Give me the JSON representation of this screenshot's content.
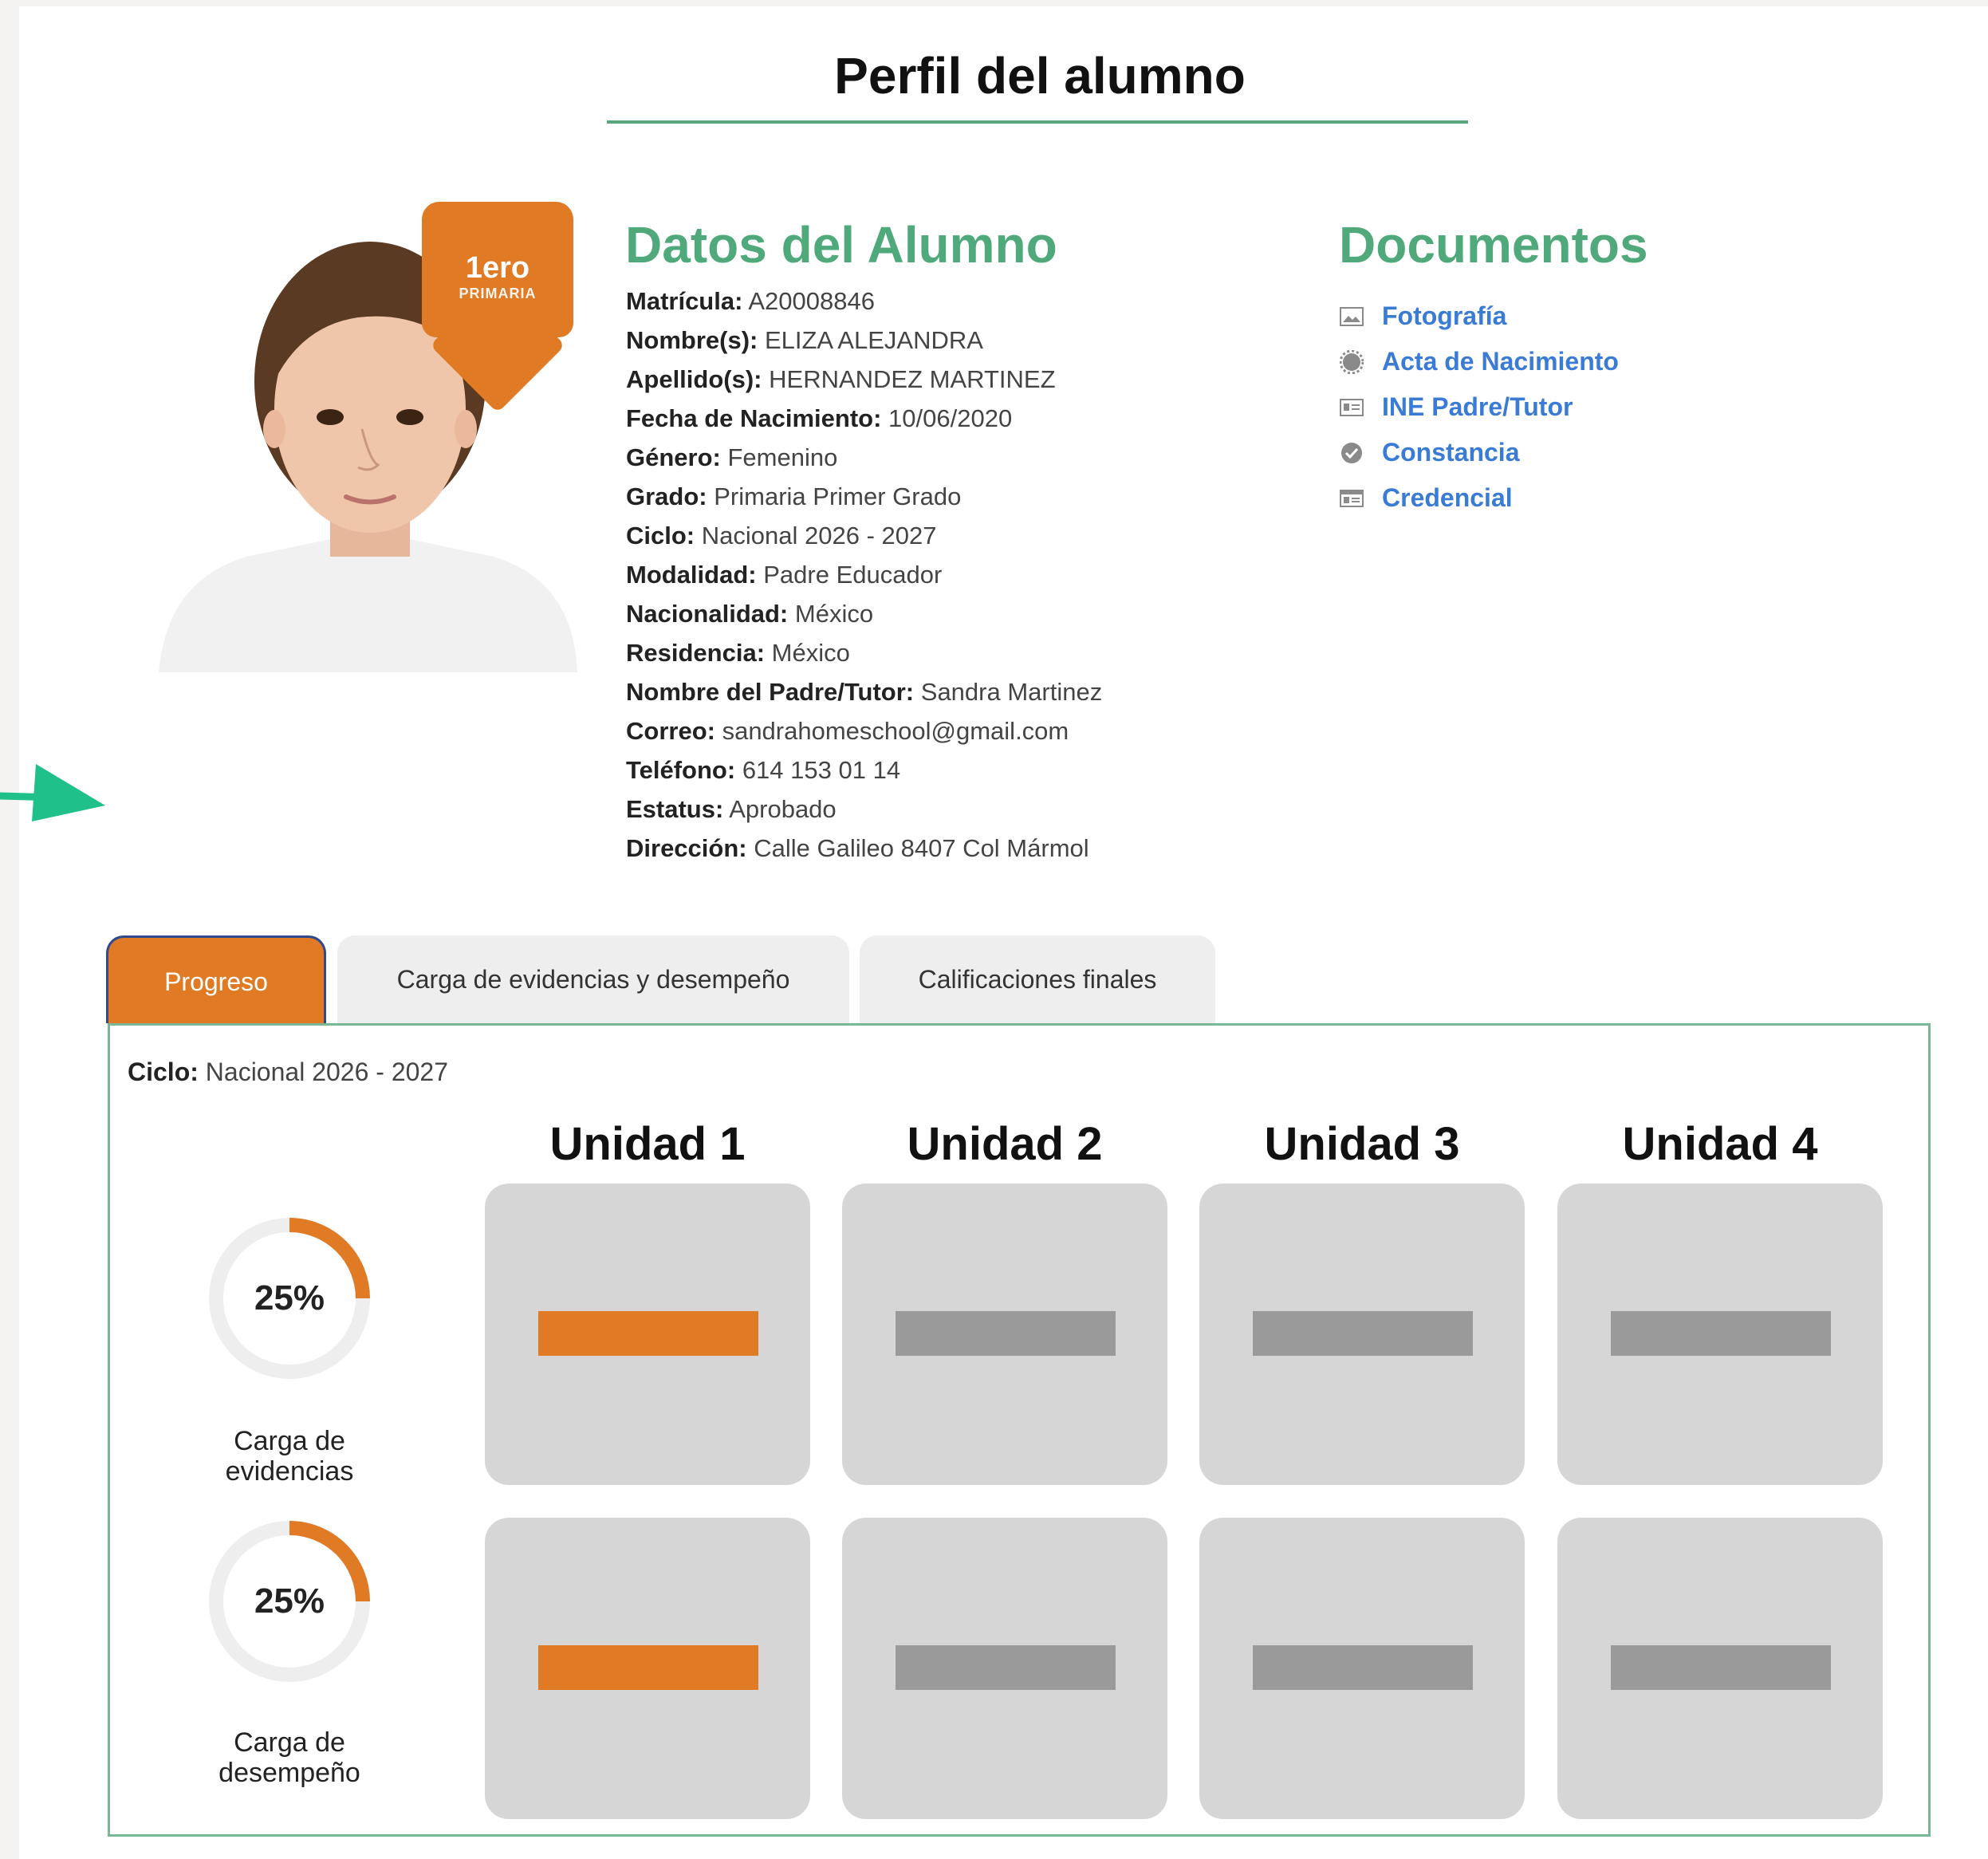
{
  "page_title": "Perfil del alumno",
  "badge": {
    "grade": "1ero",
    "level": "PRIMARIA"
  },
  "datos": {
    "title": "Datos del Alumno",
    "rows": [
      {
        "label": "Matrícula:",
        "value": "A20008846"
      },
      {
        "label": "Nombre(s):",
        "value": "ELIZA ALEJANDRA"
      },
      {
        "label": "Apellido(s):",
        "value": "HERNANDEZ MARTINEZ"
      },
      {
        "label": "Fecha de Nacimiento:",
        "value": "10/06/2020"
      },
      {
        "label": "Género:",
        "value": "Femenino"
      },
      {
        "label": "Grado:",
        "value": "Primaria Primer Grado"
      },
      {
        "label": "Ciclo:",
        "value": "Nacional 2026 - 2027"
      },
      {
        "label": "Modalidad:",
        "value": "Padre Educador"
      },
      {
        "label": "Nacionalidad:",
        "value": "México"
      },
      {
        "label": "Residencia:",
        "value": "México"
      },
      {
        "label": "Nombre del Padre/Tutor:",
        "value": "Sandra Martinez"
      },
      {
        "label": "Correo:",
        "value": "sandrahomeschool@gmail.com"
      },
      {
        "label": "Teléfono:",
        "value": "614 153 01 14"
      },
      {
        "label": "Estatus:",
        "value": "Aprobado"
      },
      {
        "label": "Dirección:",
        "value": "Calle Galileo 8407 Col Mármol"
      }
    ]
  },
  "documentos": {
    "title": "Documentos",
    "items": [
      {
        "label": "Fotografía",
        "icon": "image-icon"
      },
      {
        "label": "Acta de Nacimiento",
        "icon": "seal-icon"
      },
      {
        "label": "INE Padre/Tutor",
        "icon": "id-card-icon"
      },
      {
        "label": "Constancia",
        "icon": "check-circle-icon"
      },
      {
        "label": "Credencial",
        "icon": "credential-icon"
      }
    ]
  },
  "tabs": [
    {
      "label": "Progreso",
      "active": true
    },
    {
      "label": "Carga de evidencias y desempeño",
      "active": false
    },
    {
      "label": "Calificaciones finales",
      "active": false
    }
  ],
  "progreso": {
    "ciclo_label": "Ciclo:",
    "ciclo_value": "Nacional 2026 - 2027",
    "units": [
      "Unidad 1",
      "Unidad 2",
      "Unidad 3",
      "Unidad 4"
    ],
    "metrics": [
      {
        "percent_label": "25%",
        "fraction": 0.25,
        "label_line1": "Carga de",
        "label_line2": "evidencias",
        "unit_status": [
          "complete",
          "pending",
          "pending",
          "pending"
        ]
      },
      {
        "percent_label": "25%",
        "fraction": 0.25,
        "label_line1": "Carga de",
        "label_line2": "desempeño",
        "unit_status": [
          "complete",
          "pending",
          "pending",
          "pending"
        ]
      }
    ]
  },
  "colors": {
    "accent_orange": "#e07a25",
    "accent_green": "#4fa97a",
    "link_blue": "#3a7bd5",
    "pending_gray": "#9a9a9a",
    "tab_border": "#2f4a8f"
  }
}
